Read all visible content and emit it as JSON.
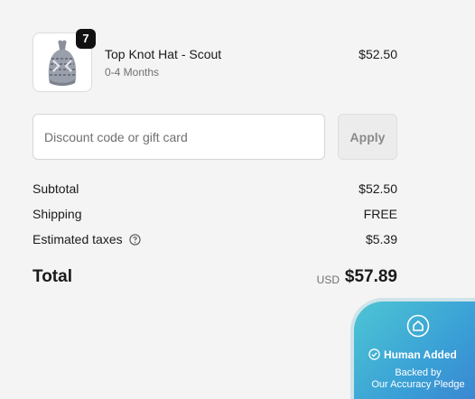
{
  "product": {
    "name": "Top Knot Hat - Scout",
    "variant": "0-4 Months",
    "price": "$52.50",
    "quantity": "7"
  },
  "discount": {
    "placeholder": "Discount code or gift card",
    "value": "",
    "apply_label": "Apply"
  },
  "summary": {
    "subtotal_label": "Subtotal",
    "subtotal_value": "$52.50",
    "shipping_label": "Shipping",
    "shipping_value": "FREE",
    "taxes_label": "Estimated taxes",
    "taxes_value": "$5.39",
    "total_label": "Total",
    "currency": "USD",
    "total_value": "$57.89"
  },
  "badge": {
    "title": "Human Added",
    "line1": "Backed by",
    "line2": "Our Accuracy Pledge"
  },
  "icons": {
    "help": "question-circle-icon",
    "badge_home": "home-icon",
    "badge_check": "check-circle-icon"
  },
  "colors": {
    "background": "#f4f4f4",
    "badge_gradient_start": "#4dc5d3",
    "badge_gradient_end": "#3b7fd0"
  }
}
